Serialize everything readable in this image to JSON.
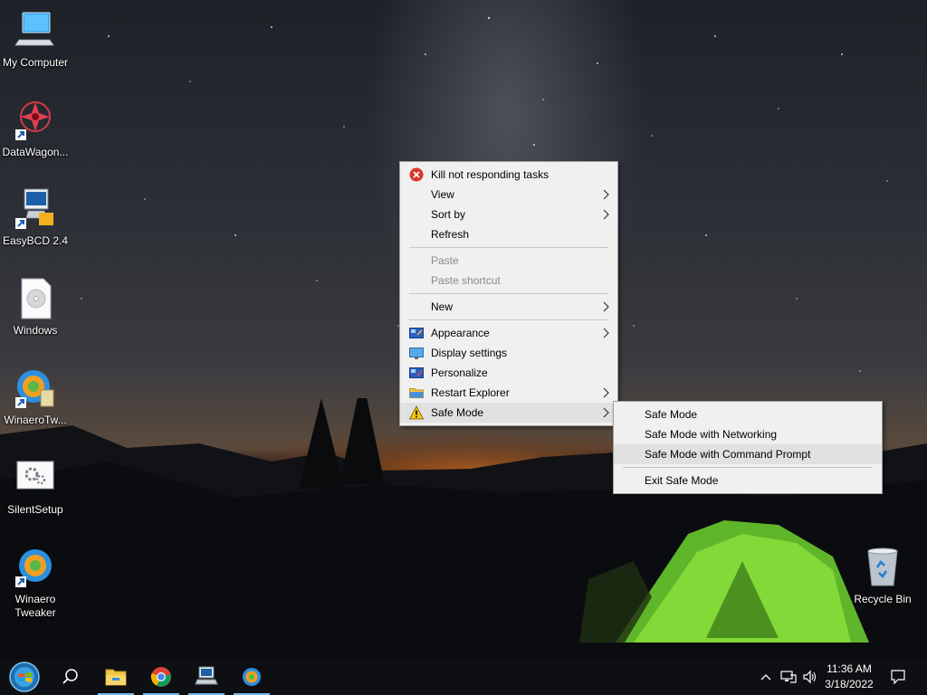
{
  "desktop": {
    "icons": [
      {
        "label": "My Computer",
        "icon": "computer-icon"
      },
      {
        "label": "DataWagon...",
        "icon": "datawagon-shortcut-icon"
      },
      {
        "label": "EasyBCD 2.4",
        "icon": "easybcd-shortcut-icon"
      },
      {
        "label": "Windows",
        "icon": "disc-file-icon"
      },
      {
        "label": "WinaeroTw...",
        "icon": "winaero-tweaker-shortcut-icon"
      },
      {
        "label": "SilentSetup",
        "icon": "settings-file-icon"
      },
      {
        "label": "Winaero Tweaker",
        "icon": "winaero-tweaker-shortcut-icon"
      },
      {
        "label": "Recycle Bin",
        "icon": "recycle-bin-icon"
      }
    ]
  },
  "context_menu": {
    "items": [
      {
        "label": "Kill not responding tasks",
        "icon": "red-x-icon"
      },
      {
        "label": "View",
        "submenu": true
      },
      {
        "label": "Sort by",
        "submenu": true
      },
      {
        "label": "Refresh"
      },
      {
        "label": "Paste",
        "disabled": true
      },
      {
        "label": "Paste shortcut",
        "disabled": true
      },
      {
        "label": "New",
        "submenu": true
      },
      {
        "label": "Appearance",
        "icon": "appearance-icon",
        "submenu": true
      },
      {
        "label": "Display settings",
        "icon": "display-icon"
      },
      {
        "label": "Personalize",
        "icon": "personalize-icon"
      },
      {
        "label": "Restart Explorer",
        "icon": "folder-icon",
        "submenu": true
      },
      {
        "label": "Safe Mode",
        "icon": "warning-icon",
        "submenu": true,
        "highlighted": true
      }
    ]
  },
  "safe_mode_submenu": {
    "items": [
      {
        "label": "Safe Mode"
      },
      {
        "label": "Safe Mode with Networking"
      },
      {
        "label": "Safe Mode with Command Prompt",
        "highlighted": true
      },
      {
        "label": "Exit Safe Mode"
      }
    ]
  },
  "taskbar": {
    "apps": [
      "start-button",
      "search-icon",
      "file-explorer-icon",
      "chrome-icon",
      "computer-app-icon",
      "winaero-app-icon"
    ],
    "tray_icons": [
      "chevron-up-icon",
      "network-icon",
      "volume-icon"
    ],
    "time": "11:36 AM",
    "date": "3/18/2022",
    "notification_icon": "notification-icon"
  },
  "colors": {
    "menu_bg": "#f0f0f0",
    "menu_hover": "#e1e1e1",
    "taskbar_bg": "#0e0f12",
    "accent": "#76b9ed"
  }
}
